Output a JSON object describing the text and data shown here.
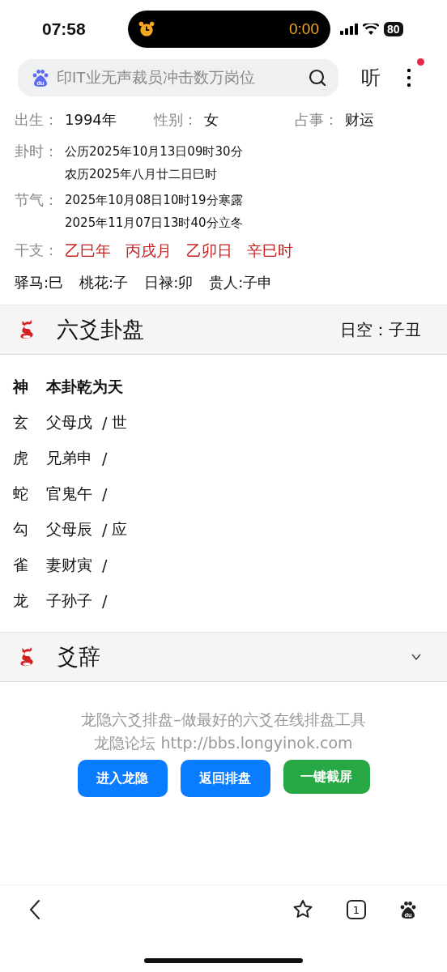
{
  "status_bar": {
    "time": "07:58",
    "timer": "0:00",
    "battery": "80"
  },
  "search": {
    "logo_text": "du",
    "placeholder": "印IT业无声裁员冲击数万岗位",
    "listen_button": "听",
    "menu_notification": true
  },
  "summary": [
    {
      "label": "出生：",
      "value": "1994年"
    },
    {
      "label": "性别：",
      "value": "女"
    },
    {
      "label": "占事：",
      "value": "财运"
    }
  ],
  "details": [
    {
      "label": "卦时：",
      "kind": "stacked",
      "lines": [
        "公历2025年10月13日09时30分",
        "农历2025年八月廿二日巳时"
      ]
    },
    {
      "label": "节气：",
      "kind": "stacked",
      "lines": [
        "2025年10月08日10时19分寒露",
        "2025年11月07日13时40分立冬"
      ]
    },
    {
      "label": "干支：",
      "kind": "pillars",
      "lines": [
        "乙巳年",
        "丙戌月",
        "乙卯日",
        "辛巳时"
      ]
    }
  ],
  "shensha": [
    "驿马:巳",
    "桃花:子",
    "日禄:卯",
    "贵人:子申"
  ],
  "chart_section": {
    "title": "六爻卦盘",
    "day_void_label": "日空：",
    "day_void": "子丑"
  },
  "hexagram": {
    "header": {
      "spirit": "神",
      "name": "本卦乾为天"
    },
    "lines": [
      {
        "spirit": "玄",
        "relation": "父母戊",
        "mark": "/",
        "role": "世"
      },
      {
        "spirit": "虎",
        "relation": "兄弟申",
        "mark": "/"
      },
      {
        "spirit": "蛇",
        "relation": "官鬼午",
        "mark": "/"
      },
      {
        "spirit": "勾",
        "relation": "父母辰",
        "mark": "/",
        "role": "应"
      },
      {
        "spirit": "雀",
        "relation": "妻财寅",
        "mark": "/"
      },
      {
        "spirit": "龙",
        "relation": "子孙子",
        "mark": "/"
      }
    ]
  },
  "yaoci_section": {
    "title": "爻辞",
    "expanded": false
  },
  "footer": {
    "lines": [
      "龙隐六爻排盘–做最好的六爻在线排盘工具",
      "龙隐论坛 http://bbs.longyinok.com"
    ],
    "buttons": [
      {
        "label": "进入龙隐",
        "kind": "primary"
      },
      {
        "label": "返回排盘",
        "kind": "primary"
      },
      {
        "label": "一键截屏",
        "kind": "success"
      }
    ]
  },
  "bottom_bar": {
    "tab_count": "1",
    "logo_text": "du"
  }
}
